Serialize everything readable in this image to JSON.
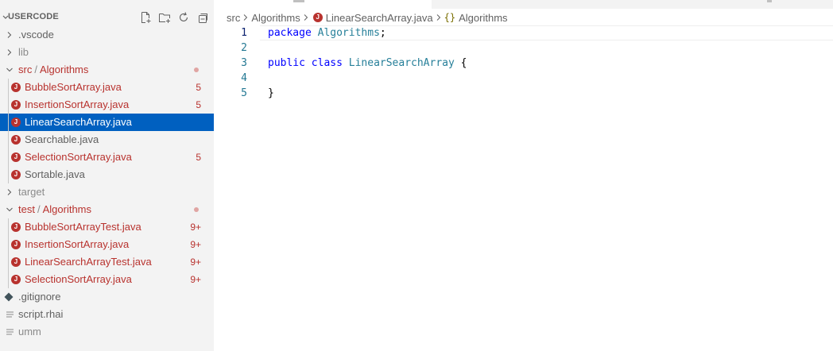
{
  "sidebar": {
    "title": "USERCODE",
    "actions": [
      "new-file-icon",
      "new-folder-icon",
      "refresh-icon",
      "collapse-all-icon"
    ],
    "items": [
      {
        "type": "folder",
        "name": "vscode-folder",
        "label": ".vscode",
        "expanded": false,
        "depth": 0,
        "color": "#616161"
      },
      {
        "type": "folder",
        "name": "lib-folder",
        "label": "lib",
        "expanded": false,
        "depth": 0,
        "color": "#8a8a8a"
      },
      {
        "type": "folder",
        "name": "src-algorithms-folder",
        "label_a": "src",
        "label_b": "Algorithms",
        "expanded": true,
        "depth": 0,
        "color": "#b8322e",
        "dot": true
      },
      {
        "type": "java",
        "name": "file-bubblesortarray",
        "label": "BubbleSortArray.java",
        "depth": 1,
        "color": "#b8322e",
        "badge": "5"
      },
      {
        "type": "java",
        "name": "file-insertionsortarray",
        "label": "InsertionSortArray.java",
        "depth": 1,
        "color": "#b8322e",
        "badge": "5"
      },
      {
        "type": "java",
        "name": "file-linearsearcharray",
        "label": "LinearSearchArray.java",
        "depth": 1,
        "color": "#ffffff",
        "selected": true
      },
      {
        "type": "java",
        "name": "file-searchable",
        "label": "Searchable.java",
        "depth": 1,
        "color": "#616161"
      },
      {
        "type": "java",
        "name": "file-selectionsortarray",
        "label": "SelectionSortArray.java",
        "depth": 1,
        "color": "#b8322e",
        "badge": "5"
      },
      {
        "type": "java",
        "name": "file-sortable",
        "label": "Sortable.java",
        "depth": 1,
        "color": "#616161"
      },
      {
        "type": "folder",
        "name": "target-folder",
        "label": "target",
        "expanded": false,
        "depth": 0,
        "color": "#8a8a8a"
      },
      {
        "type": "folder",
        "name": "test-algorithms-folder",
        "label_a": "test",
        "label_b": "Algorithms",
        "expanded": true,
        "depth": 0,
        "color": "#b8322e",
        "dot": true
      },
      {
        "type": "java",
        "name": "file-bubblesortarraytest",
        "label": "BubbleSortArrayTest.java",
        "depth": 1,
        "color": "#b8322e",
        "badge": "9+"
      },
      {
        "type": "java",
        "name": "file-insertionsortarray-test",
        "label": "InsertionSortArray.java",
        "depth": 1,
        "color": "#b8322e",
        "badge": "9+"
      },
      {
        "type": "java",
        "name": "file-linearsearcharraytest",
        "label": "LinearSearchArrayTest.java",
        "depth": 1,
        "color": "#b8322e",
        "badge": "9+"
      },
      {
        "type": "java",
        "name": "file-selectionsortarray-test",
        "label": "SelectionSortArray.java",
        "depth": 1,
        "color": "#b8322e",
        "badge": "9+"
      },
      {
        "type": "git",
        "name": "file-gitignore",
        "label": ".gitignore",
        "depth": 0,
        "color": "#616161"
      },
      {
        "type": "text",
        "name": "file-script-rhai",
        "label": "script.rhai",
        "depth": 0,
        "color": "#616161"
      },
      {
        "type": "text",
        "name": "file-umm",
        "label": "umm",
        "depth": 0,
        "color": "#8a8a8a"
      }
    ]
  },
  "breadcrumb": {
    "folder1": "src",
    "folder2": "Algorithms",
    "file": "LinearSearchArray.java",
    "symbol_brace": "{}",
    "symbol": "Algorithms"
  },
  "editor": {
    "lines": [
      {
        "num": "1",
        "tokens": [
          {
            "t": "package",
            "c": "kw"
          },
          {
            "t": " ",
            "c": "pl"
          },
          {
            "t": "Algorithms",
            "c": "ty"
          },
          {
            "t": ";",
            "c": "pl"
          }
        ],
        "current": true
      },
      {
        "num": "2",
        "tokens": []
      },
      {
        "num": "3",
        "tokens": [
          {
            "t": "public",
            "c": "kw"
          },
          {
            "t": " ",
            "c": "pl"
          },
          {
            "t": "class",
            "c": "kw"
          },
          {
            "t": " ",
            "c": "pl"
          },
          {
            "t": "LinearSearchArray",
            "c": "ty"
          },
          {
            "t": " {",
            "c": "pl"
          }
        ]
      },
      {
        "num": "4",
        "tokens": []
      },
      {
        "num": "5",
        "tokens": [
          {
            "t": "}",
            "c": "pl"
          }
        ]
      }
    ]
  },
  "colors": {
    "selection": "#0060c0",
    "error": "#b8322e",
    "dot": "#e0a5a3"
  }
}
